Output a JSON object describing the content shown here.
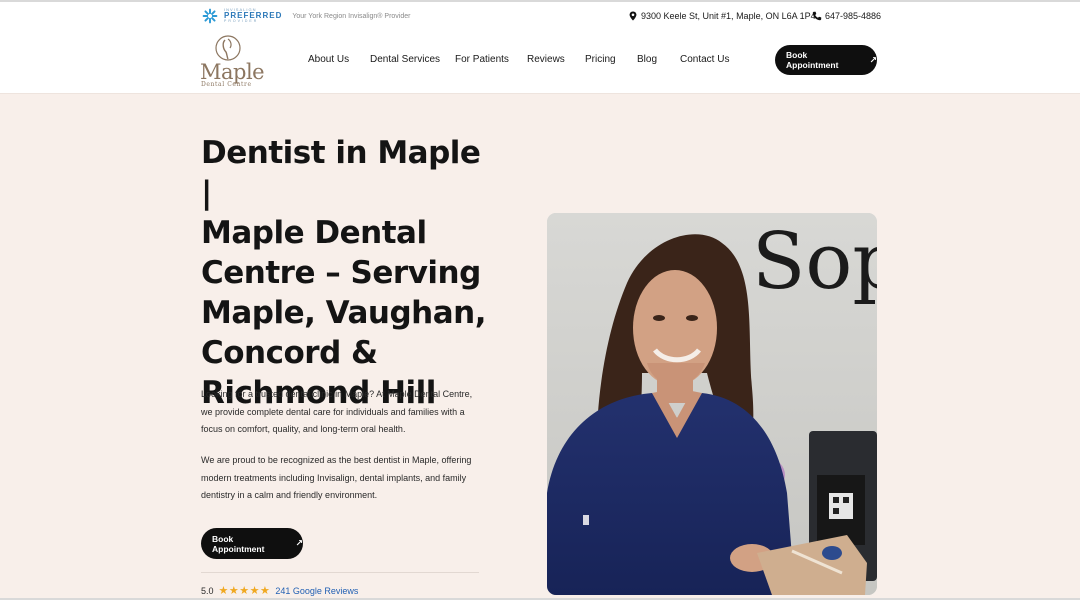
{
  "topbar": {
    "badge_small": "INVISALIGN",
    "badge_main": "PREFERRED",
    "badge_sub": "PROVIDER",
    "badge_caption": "Your York Region Invisalign® Provider",
    "address": "9300 Keele St, Unit #1, Maple, ON L6A 1P4",
    "phone": "647-985-4886"
  },
  "logo": {
    "word": "Maple",
    "sub": "Dental Centre"
  },
  "nav": {
    "items": [
      "About Us",
      "Dental Services",
      "For Patients",
      "Reviews",
      "Pricing",
      "Blog",
      "Contact Us"
    ],
    "cta": "Book Appointment"
  },
  "hero": {
    "title_lines": [
      "Dentist in Maple |",
      "Maple Dental",
      "Centre – Serving",
      "Maple, Vaughan,",
      "Concord &",
      "Richmond Hill"
    ],
    "paragraph1": "Looking for a trusted dental clinic in Maple? At Maple Dental Centre, we provide complete dental care for individuals and families with a focus on comfort, quality, and long-term oral health.",
    "paragraph2": "We are proud to be recognized as the best dentist in Maple, offering modern treatments including Invisalign, dental implants, and family dentistry in a calm and friendly environment.",
    "cta": "Book Appointment",
    "rating_score": "5.0",
    "rating_stars": 5,
    "reviews_link": "241 Google Reviews",
    "sign_text": "Sop"
  },
  "colors": {
    "hero_bg": "#f8efea",
    "button_bg": "#0f0f0f",
    "link": "#2361b4",
    "star": "#f0a820",
    "logo": "#8c7660",
    "badge": "#2b78b8"
  }
}
